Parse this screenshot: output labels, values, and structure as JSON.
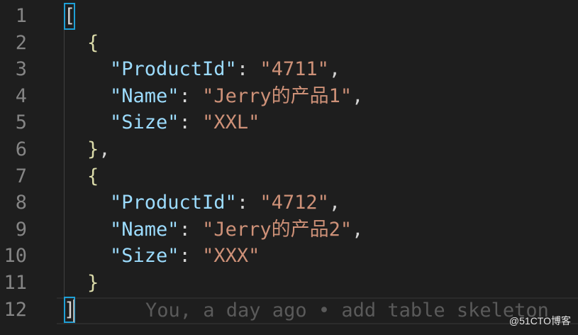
{
  "editor": {
    "line_numbers": [
      "1",
      "2",
      "3",
      "4",
      "5",
      "6",
      "7",
      "8",
      "9",
      "10",
      "11",
      "12"
    ],
    "lines": {
      "l1": {
        "open_bracket": "["
      },
      "l2": {
        "brace": "{"
      },
      "l3": {
        "key": "\"ProductId\"",
        "colon": ": ",
        "value": "\"4711\"",
        "comma": ","
      },
      "l4": {
        "key": "\"Name\"",
        "colon": ": ",
        "value": "\"Jerry的产品1\"",
        "comma": ","
      },
      "l5": {
        "key": "\"Size\"",
        "colon": ": ",
        "value": "\"XXL\""
      },
      "l6": {
        "brace": "}",
        "comma": ","
      },
      "l7": {
        "brace": "{"
      },
      "l8": {
        "key": "\"ProductId\"",
        "colon": ": ",
        "value": "\"4712\"",
        "comma": ","
      },
      "l9": {
        "key": "\"Name\"",
        "colon": ": ",
        "value": "\"Jerry的产品2\"",
        "comma": ","
      },
      "l10": {
        "key": "\"Size\"",
        "colon": ": ",
        "value": "\"XXX\""
      },
      "l11": {
        "brace": "}"
      },
      "l12": {
        "close_bracket": "]"
      }
    },
    "blame_annotation": "You, a day ago • add table skeleton",
    "colors": {
      "background": "#1e1e1e",
      "key": "#9cdcfe",
      "string": "#ce9178",
      "brace": "#dcdcaa",
      "bracket_match_box": "#1f9fd6",
      "line_number": "#858585"
    }
  },
  "watermark": "@51CTO博客"
}
